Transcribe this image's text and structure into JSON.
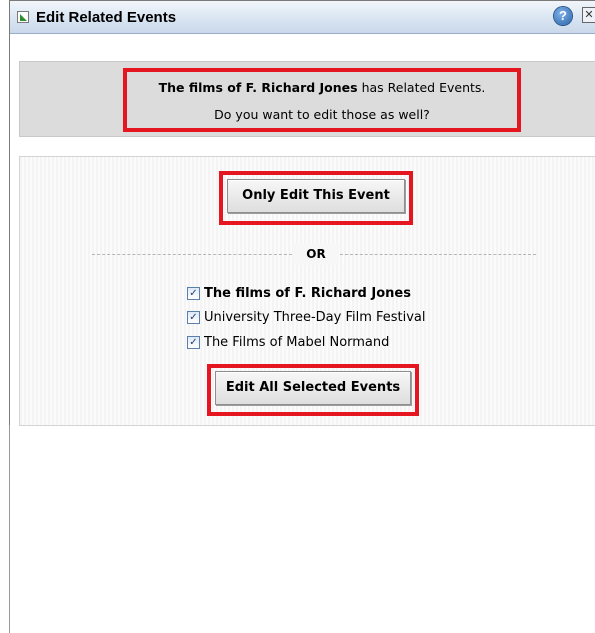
{
  "dialog": {
    "title": "Edit Related Events",
    "help_icon_glyph": "?",
    "close_icon_glyph": "✕"
  },
  "banner": {
    "event_name": "The films of F. Richard Jones",
    "message_suffix": " has Related Events.",
    "question": "Do you want to edit those as well?"
  },
  "actions": {
    "only_edit_label": "Only Edit This Event",
    "or_label": "OR",
    "edit_all_label": "Edit All Selected Events"
  },
  "events": [
    {
      "label": "The films of F. Richard Jones",
      "checked": true,
      "bold": true
    },
    {
      "label": "University Three-Day Film Festival",
      "checked": true,
      "bold": false
    },
    {
      "label": "The Films of Mabel Normand",
      "checked": true,
      "bold": false
    }
  ],
  "colors": {
    "highlight": "#e5161f",
    "banner_bg": "#dcdcdc"
  }
}
